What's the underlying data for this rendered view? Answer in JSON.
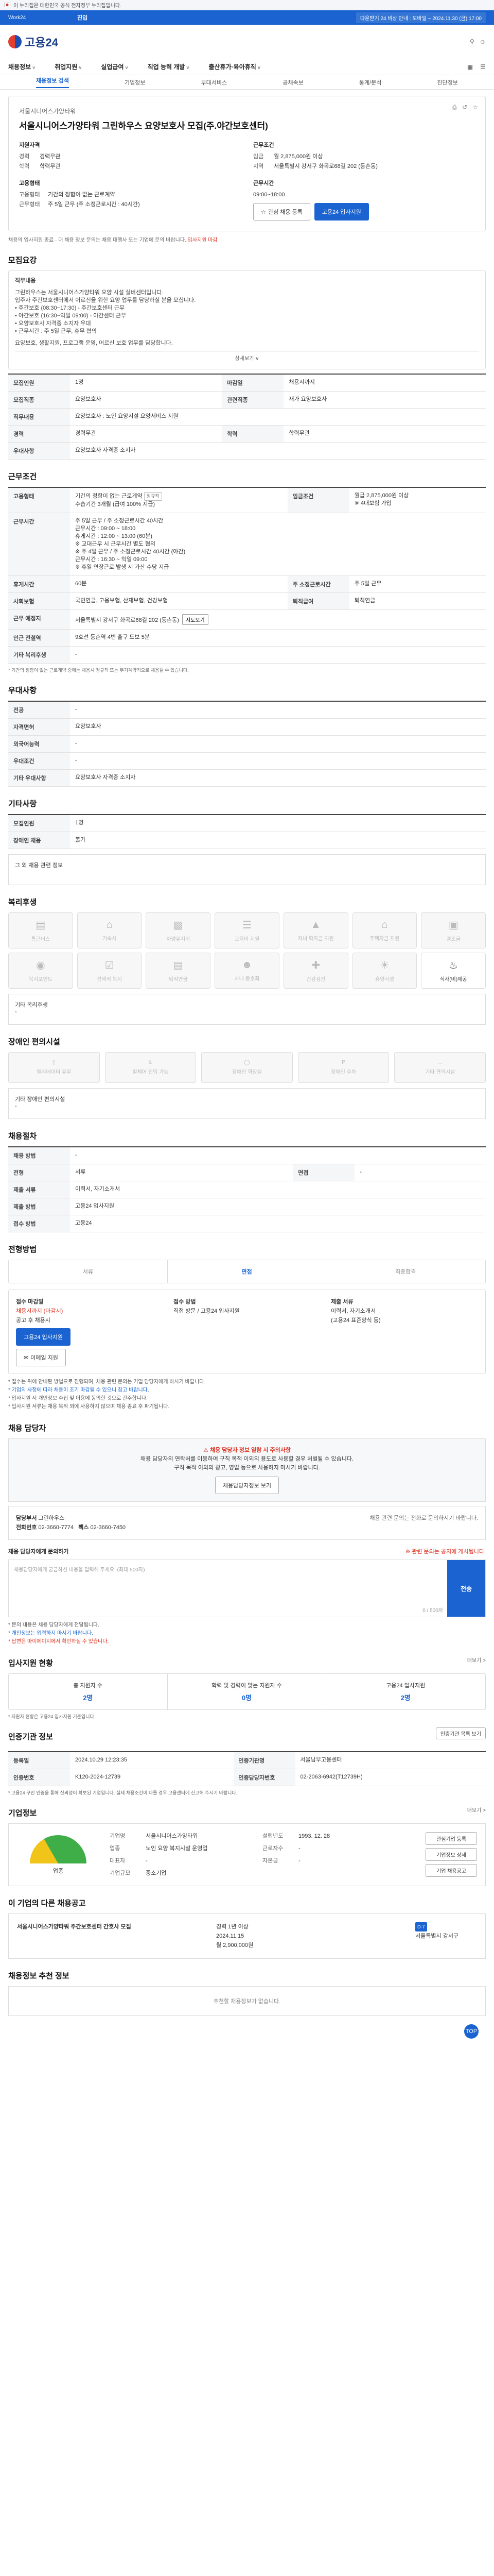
{
  "gov": {
    "text": "이 누리집은 대한민국 공식 전자정부 누리집입니다."
  },
  "topbar": {
    "left": "Work24",
    "center": "진입",
    "right": "다운받기 24 비상 안내 : 모바일 ~ 2024.11.30 (금) 17:00"
  },
  "header": {
    "logo": "고용24"
  },
  "gnb": {
    "items": [
      "채용정보",
      "취업지원",
      "실업급여",
      "직업 능력 개발",
      "출산휴가·육아휴직"
    ],
    "caret": "v"
  },
  "subtabs": [
    "채용정보 검색",
    "기업정보",
    "부대서비스",
    "공채속보",
    "통계/분석",
    "진단정보"
  ],
  "job": {
    "company": "서울시니어스가양타워",
    "title": "서울시니어스가양타워 그린하우스 요양보호사 모집(주.야간보호센터)",
    "apply_title": "지원자격",
    "apply": [
      [
        "경력",
        "경력무관"
      ],
      [
        "학력",
        "학력무관"
      ]
    ],
    "cond_title": "근무조건",
    "cond": [
      [
        "임금",
        "월 2,875,000원 이상"
      ],
      [
        "지역",
        "서울특별시 강서구 화곡로68길 202 (등촌동)"
      ]
    ],
    "type_title": "고용형태",
    "type": [
      [
        "고용형태",
        "기간의 정함이 없는 근로계약"
      ],
      [
        "근무형태",
        "주 5일 근무 (주 소정근로시간 : 40시간)"
      ]
    ],
    "hours_title": "근무시간",
    "hours": "09:00~18:00",
    "btn_save": "관심 채용 등록",
    "btn_apply": "고용24 입사지원",
    "note": "채용의 입사지원 종료 · 더 채용 정보 문의는 채용 대행사 또는 기업에 문의 바랍니다.",
    "note_red": "입사지원 마감"
  },
  "sec_content": "모집요강",
  "content": {
    "heading": "직무내용",
    "lines": [
      "그린하우스는 서울시니어스가양타워 요양 시설 실버센터입니다.",
      "입주자 주간보호센터에서 어르신을 위한 요양 업무를 담당하실 분을 모십니다.",
      "• 주간보호 (08:30~17:30) - 주간보호센터 근무",
      "• 야간보호 (16:30~익일 09:00) - 야간센터 근무",
      "• 요양보호사 자격증 소지자 우대",
      "• 근무시간 : 주 5일 근무, 휴무 협의",
      "요양보호, 생활지원, 프로그램 운영, 어르신 보호 업무를 담당합니다."
    ],
    "more": "상세보기 ∨"
  },
  "detail1": [
    [
      "모집인원",
      "1명",
      "마감일",
      "채용시까지"
    ],
    [
      "모집직종",
      "요양보호사",
      "관련직종",
      "재가 요양보호사"
    ],
    [
      "직무내용",
      "요양보호사 : 노인 요양시설 요양서비스 지원",
      "",
      ""
    ],
    [
      "경력",
      "경력무관",
      "학력",
      "학력무관"
    ],
    [
      "우대사항",
      "요양보호사 자격증 소지자",
      "",
      ""
    ]
  ],
  "sec_cond": "근무조건",
  "cond_table": {
    "type_label": "고용형태",
    "type_val": "기간의 정함이 없는 근로계약",
    "type_tag": "정규직",
    "type_sub": "수습기간 3개월 (급여 100% 지급)",
    "pay_label": "임금조건",
    "pay_val": "월급 2,875,000원 이상",
    "pay_sub": "※ 4대보험 가입",
    "time_label": "근무시간",
    "time_lines": [
      "주 5일 근무 / 주 소정근로시간 40시간",
      "근무시간 : 09:00 ~ 18:00",
      "휴게시간 : 12:00 ~ 13:00 (60분)",
      "※ 교대근무 시 근무시간 별도 협의",
      "※ 주 4일 근무 / 주 소정근로시간 40시간 (야간)",
      "근무시간 : 16:30 ~ 익일 09:00",
      "※ 휴일 연장근로 발생 시 가산 수당 지급"
    ],
    "rest_label": "휴게시간",
    "rest_val": "60분",
    "rest_label2": "주 소정근로시간",
    "rest_val2": "주 5일 근무",
    "wel_label": "사회보험",
    "wel_val": "국민연금, 고용보험, 산재보험, 건강보험",
    "wel_label2": "퇴직급여",
    "wel_val2": "퇴직연금",
    "loc_label": "근무 예정지",
    "loc_val": "서울특별시 강서구 화곡로68길 202 (등촌동)",
    "map_btn": "지도보기",
    "near_label": "인근 전철역",
    "near_val": "9호선 등촌역 4번 출구 도보 5분",
    "etc_label": "기타 복리후생",
    "etc_val": "-"
  },
  "cond_note": "* 기간의 정함이 없는 근로계약 중에는 채용시 정규직 또는 무기계약직으로 채용될 수 있습니다.",
  "sec_apply": "우대사항",
  "apply_rows": [
    [
      "전공",
      "-"
    ],
    [
      "자격면허",
      "요양보호사"
    ],
    [
      "외국어능력",
      "-"
    ],
    [
      "우대조건",
      "-"
    ],
    [
      "기타 우대사항",
      "요양보호사 자격증 소지자"
    ]
  ],
  "sec_other": "기타사항",
  "other_rows": [
    [
      "모집인원",
      "1명"
    ],
    [
      "장애인 채용",
      "불가"
    ]
  ],
  "other_note_title": "그 외 채용 관련 정보",
  "sec_welfare": "복리후생",
  "welfare": [
    "통근버스",
    "기숙사",
    "차량유지비",
    "교육비 지원",
    "자녀 학자금 지원",
    "주택자금 지원",
    "경조금",
    "복지포인트",
    "선택적 복지",
    "퇴직연금",
    "사내 동호회",
    "건강검진",
    "휴양시설",
    "식사(비)제공"
  ],
  "welfare_on": [
    13
  ],
  "welfare_etc_title": "기타 복리후생",
  "welfare_etc_val": "-",
  "sec_disabled": "장애인 편의시설",
  "disabled": [
    "엘리베이터 유무",
    "휠체어 진입 가능",
    "장애인 화장실",
    "장애인 주차",
    "기타 편의시설"
  ],
  "disabled_etc_title": "기타 장애인 편의시설",
  "disabled_etc_val": "-",
  "sec_process": "채용절차",
  "process_rows": [
    [
      "채용 방법",
      "-",
      "",
      ""
    ],
    [
      "전형",
      "서류",
      "면접",
      "-"
    ],
    [
      "제출 서류",
      "이력서, 자기소개서",
      "",
      ""
    ],
    [
      "제출 방법",
      "고용24 입사지원",
      "",
      ""
    ],
    [
      "접수 방법",
      "고용24",
      "",
      ""
    ]
  ],
  "sec_method": "전형방법",
  "steps": [
    "서류",
    "면접",
    "최종합격"
  ],
  "steps_on": 1,
  "apply_box": {
    "c1_title": "접수 마감일",
    "c1_red": "채용시까지 (마감시)",
    "c1_sub": "공고 후 채용시",
    "btn_apply": "고용24 입사지원",
    "btn_mail": "이메일 지원",
    "c2_title": "접수 방법",
    "c2_val": "직접 방문 / 고용24 입사지원",
    "c3_title": "제출 서류",
    "c3_lines": [
      "이력서, 자기소개서",
      "(고용24 표준양식 등)"
    ]
  },
  "apply_bullets": [
    "* 접수는 위에 안내된 방법으로 진행되며, 채용 관련 문의는 기업 담당자에게 하시기 바랍니다.",
    "* 기업의 사정에 따라 채용이 조기 마감될 수 있으니 참고 바랍니다.",
    "* 입사지원 시 개인정보 수집 및 이용에 동의한 것으로 간주합니다.",
    "* 입사지원 서류는 채용 목적 외에 사용하지 않으며 채용 종료 후 파기됩니다."
  ],
  "sec_manager": "채용 담당자",
  "alert": {
    "red": "채용 담당자 정보 열람 시 주의사항",
    "l1": "채용 담당자의 연락처를 이용하여 구직 목적 이외의 용도로 사용할 경우 처벌될 수 있습니다.",
    "l2": "구직 목적 이외의 광고, 영업 등으로 사용하지 마시기 바랍니다.",
    "btn": "채용담당자정보 보기"
  },
  "mgr": {
    "name_label": "담당부서",
    "name": "그린하우스",
    "tel_label": "전화번호",
    "tel": "02-3660-7774",
    "fax_label": "팩스",
    "fax": "02-3660-7450",
    "right": "채용 관련 문의는 전화로 문의하시기 바랍니다."
  },
  "qna": {
    "title": "채용 담당자에게 문의하기",
    "right": "※ 관련 문의는 공지에 게시됩니다.",
    "placeholder": "채용담당자에게 궁금하신 내용을 입력해 주세요. (최대 500자)",
    "count": "0 / 500자",
    "btn": "전송"
  },
  "qna_bullets": [
    "* 문의 내용은 채용 담당자에게 전달됩니다.",
    "* 개인정보는 입력하지 마시기 바랍니다.",
    "* 답변은 마이페이지에서 확인하실 수 있습니다."
  ],
  "sec_status": "입사지원 현황",
  "status_more": "더보기 >",
  "status": [
    [
      "총 지원자 수",
      "2명"
    ],
    [
      "학력 및 경력이 맞는 지원자 수",
      "0명"
    ],
    [
      "고용24 입사지원",
      "2명"
    ]
  ],
  "status_note": "* 지원자 현황은 고용24 입사지원 기준입니다.",
  "sec_info": "인증기관 정보",
  "info_btn": "인증기관 목록 보기",
  "info_rows": [
    [
      "등록일",
      "2024.10.29 12:23:35",
      "인증기관명",
      "서울남부고용센터"
    ],
    [
      "인증번호",
      "K120-2024-12739",
      "인증담당자번호",
      "02-2063-6942(T12739H)"
    ]
  ],
  "info_note": "* 고용24 구인 인증을 통해 신뢰성이 확보된 기업입니다. 실제 채용조건이 다를 경우 고용센터에 신고해 주시기 바랍니다.",
  "sec_corp": "기업정보",
  "corp_more": "더보기 >",
  "corp": {
    "legend": "업종",
    "rows": [
      [
        "기업명",
        "서울시니어스가양타워",
        "설립년도",
        "1993. 12. 28"
      ],
      [
        "업종",
        "노인 요양 복지시설 운영업",
        "근로자수",
        "-"
      ],
      [
        "대표자",
        "-",
        "자본금",
        "-"
      ],
      [
        "기업규모",
        "중소기업",
        "",
        ""
      ]
    ],
    "btns": [
      "관심기업 등록",
      "기업정보 상세",
      "기업 채용공고"
    ]
  },
  "sec_related": "이 기업의 다른 채용공고",
  "related": {
    "title": "서울시니어스가양타워 주간보호센터 간호사 모집",
    "r1": "경력 1년 이상",
    "r2": "2024.11.15",
    "r3": "월 2,900,000원",
    "badge": "D-7",
    "r4": "서울특별시 강서구"
  },
  "sec_recommend": "채용정보 추천 정보",
  "recommend_empty": "추천할 채용정보가 없습니다.",
  "top_btn": "TOP"
}
